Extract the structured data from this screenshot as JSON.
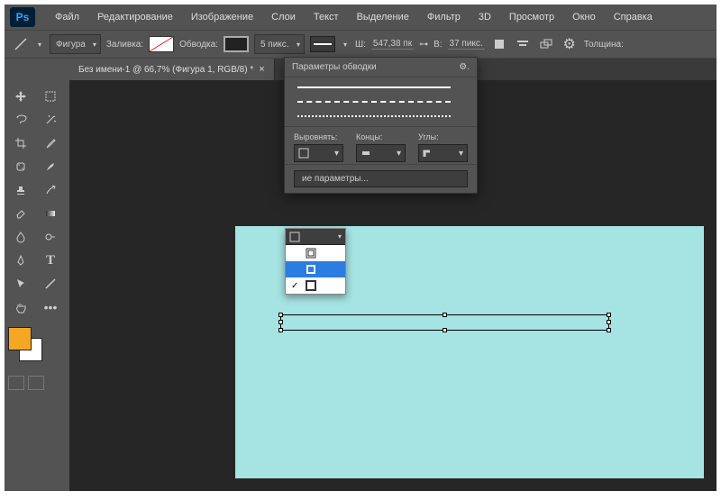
{
  "app_name": "Ps",
  "menu": [
    "Файл",
    "Редактирование",
    "Изображение",
    "Слои",
    "Текст",
    "Выделение",
    "Фильтр",
    "3D",
    "Просмотр",
    "Окно",
    "Справка"
  ],
  "options": {
    "mode": "Фигура",
    "fill_label": "Заливка:",
    "stroke_label": "Обводка:",
    "stroke_width": "5 пикс.",
    "w_label": "Ш:",
    "w_value": "547,38 пк",
    "link": "⊶",
    "h_label": "В:",
    "h_value": "37 пикс.",
    "thickness_label": "Толщина:"
  },
  "tab": {
    "title": "Без имени-1 @ 66,7% (Фигура 1, RGB/8) *"
  },
  "stroke_panel": {
    "title": "Параметры обводки",
    "align_label": "Выровнять:",
    "caps_label": "Концы:",
    "corners_label": "Углы:",
    "more_params": "ие параметры..."
  },
  "align_options": [
    "",
    "",
    ""
  ],
  "tools": {
    "row1": [
      "move",
      "marquee"
    ],
    "row2": [
      "lasso",
      "wand"
    ],
    "row3": [
      "crop",
      "eyedropper"
    ],
    "row4": [
      "patch",
      "brush"
    ],
    "row5": [
      "stamp",
      "history"
    ],
    "row6": [
      "eraser",
      "gradient"
    ],
    "row7": [
      "blur",
      "dodge"
    ],
    "row8": [
      "pen",
      "type"
    ],
    "row9": [
      "path",
      "line"
    ],
    "row10": [
      "hand",
      "zoom"
    ]
  },
  "colors": {
    "canvas": "#a6e3e3",
    "foreground": "#f5a623",
    "background": "#ffffff"
  }
}
